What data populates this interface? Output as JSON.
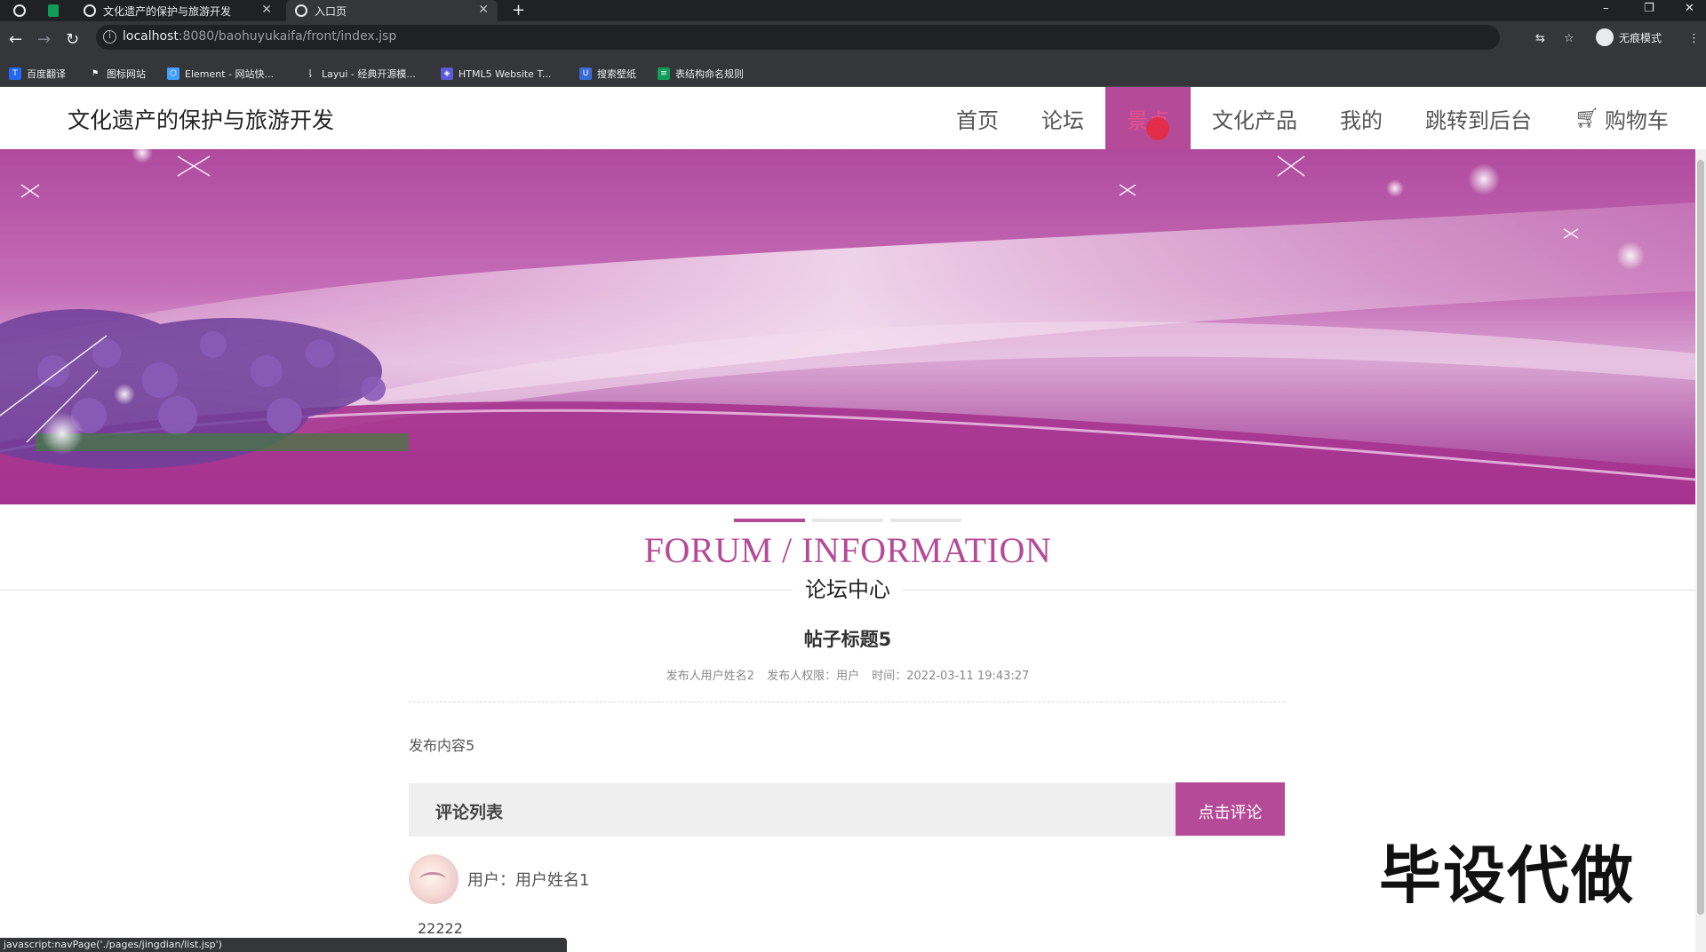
{
  "browser": {
    "tabs": [
      {
        "label": "文化遗产的保护与旅游开发"
      },
      {
        "label": "入口页"
      }
    ],
    "url_host": "localhost",
    "url_rest": ":8080/baohuyukaifa/front/index.jsp",
    "incognito_label": "无痕模式",
    "bookmarks": [
      {
        "label": "百度翻译"
      },
      {
        "label": "图标网站"
      },
      {
        "label": "Element - 网站快..."
      },
      {
        "label": "Layui - 经典开源模..."
      },
      {
        "label": "HTML5 Website T..."
      },
      {
        "label": "搜索壁纸"
      },
      {
        "label": "表结构命名规则"
      }
    ],
    "status_url": "javascript:navPage('./pages/jingdian/list.jsp')"
  },
  "site": {
    "title": "文化遗产的保护与旅游开发",
    "nav": [
      {
        "label": "首页"
      },
      {
        "label": "论坛"
      },
      {
        "label": "景点",
        "active": true
      },
      {
        "label": "文化产品"
      },
      {
        "label": "我的"
      },
      {
        "label": "跳转到后台"
      },
      {
        "label": "购物车",
        "icon": "cart-icon"
      }
    ],
    "accent_color": "#b54b98"
  },
  "section": {
    "title_en": "FORUM / INFORMATION",
    "title_zh": "论坛中心"
  },
  "post": {
    "title": "帖子标题5",
    "author": "发布人用户姓名2",
    "role": "发布人权限：用户",
    "time": "时间：2022-03-11 19:43:27",
    "content": "发布内容5"
  },
  "comments": {
    "header": "评论列表",
    "button": "点击评论",
    "items": [
      {
        "user": "用户：用户姓名1",
        "text": "22222"
      }
    ]
  },
  "watermark": "毕设代做"
}
